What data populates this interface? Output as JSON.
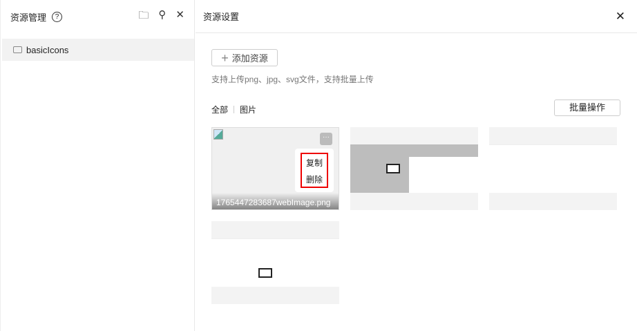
{
  "left_panel": {
    "title": "资源管理",
    "help_icon": "question-circle-icon",
    "tree": [
      {
        "label": "basicIcons",
        "icon": "folder-icon"
      }
    ]
  },
  "right_panel": {
    "title": "资源设置",
    "add_button": "添加资源",
    "hint": "支持上传png、jpg、svg文件，支持批量上传",
    "tabs": [
      {
        "label": "全部",
        "active": true
      },
      {
        "label": "图片",
        "active": false
      }
    ],
    "batch_button": "批量操作",
    "cards": [
      {
        "filename": "1765447283687webImage.png",
        "more": "···",
        "menu": [
          "复制",
          "删除"
        ]
      }
    ],
    "accent": "#e00000"
  }
}
